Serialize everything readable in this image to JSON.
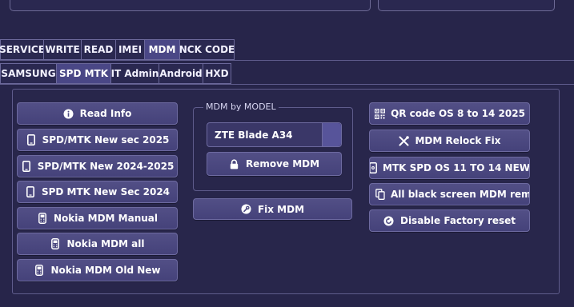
{
  "tabs_primary": [
    "SERVICE",
    "WRITE",
    "READ",
    "IMEI",
    "MDM",
    "NCK CODE"
  ],
  "tabs_secondary": [
    "SAMSUNG",
    "SPD  MTK",
    "IT Admin",
    "Android",
    "HXD"
  ],
  "left_buttons": [
    "Read Info",
    "SPD/MTK New sec 2025",
    "SPD/MTK New 2024-2025",
    "SPD  MTK New Sec 2024",
    "Nokia MDM Manual",
    "Nokia MDM all",
    "Nokia MDM Old  New"
  ],
  "mdm_model": {
    "title": "MDM by MODEL",
    "selected_model": "ZTE Blade A34",
    "remove_label": "Remove MDM"
  },
  "fix_mdm_label": "Fix MDM",
  "right_buttons": [
    "QR code OS 8 to 14 2025",
    "MDM Relock Fix",
    "MTK  SPD OS 11 TO 14 NEW",
    "All black screen MDM remove",
    "Disable Factory reset"
  ],
  "colors": {
    "background": "#27254a",
    "button": "#4b4880",
    "active_tab": "#4a4786",
    "border": "#5f5c8c"
  }
}
